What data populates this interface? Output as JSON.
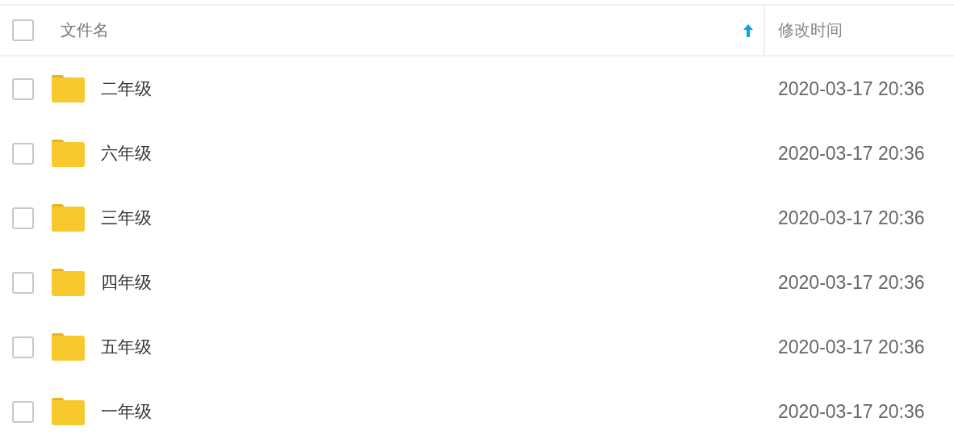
{
  "header": {
    "select_all": {
      "checked": false
    },
    "columns": [
      {
        "label": "文件名",
        "sorted": true
      },
      {
        "label": "修改时间",
        "sorted": false
      }
    ]
  },
  "rows": [
    {
      "name": "二年级",
      "modified": "2020-03-17 20:36",
      "checked": false
    },
    {
      "name": "六年级",
      "modified": "2020-03-17 20:36",
      "checked": false
    },
    {
      "name": "三年级",
      "modified": "2020-03-17 20:36",
      "checked": false
    },
    {
      "name": "四年级",
      "modified": "2020-03-17 20:36",
      "checked": false
    },
    {
      "name": "五年级",
      "modified": "2020-03-17 20:36",
      "checked": false
    },
    {
      "name": "一年级",
      "modified": "2020-03-17 20:36",
      "checked": false
    }
  ]
}
